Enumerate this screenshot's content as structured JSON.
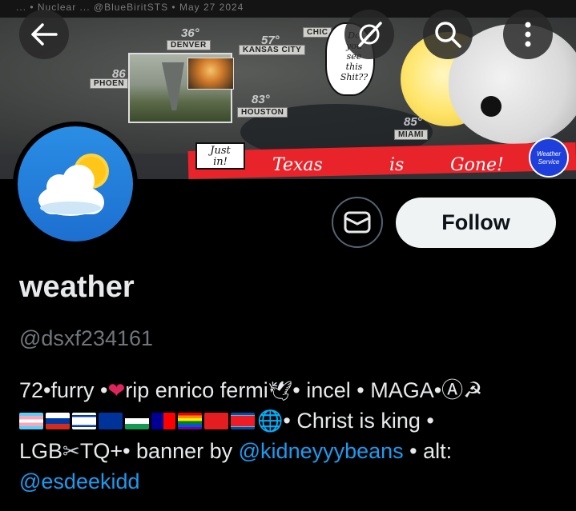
{
  "banner": {
    "top_strip_text": "... • Nuclear ... @BlueBiritSTS • May 27 2024",
    "cities": [
      "DENVER",
      "KANSAS CITY",
      "PHOEN",
      "HOUSTON",
      "MIAMI",
      "CHIC"
    ],
    "temps": [
      "36°",
      "57°",
      "86",
      "83°",
      "85°"
    ],
    "speech_bubble": "Do\nyou\nsee\nthis\nShit??",
    "just_in": "Just\nin!",
    "band_words": [
      "Texas",
      "is",
      "Gone!"
    ],
    "badge_text": "Weather Service"
  },
  "nav": {
    "back_icon": "arrow-left-icon",
    "grok_icon": "slash-circle-icon",
    "search_icon": "search-icon",
    "more_icon": "vertical-dots-icon"
  },
  "profile": {
    "display_name": "weather",
    "handle": "@dsxf234161",
    "message_icon": "envelope-icon",
    "follow_label": "Follow"
  },
  "bio": {
    "line1_a": "72•furry •",
    "line1_b": "rip enrico fermi",
    "line1_c": "• incel • MAGA•Ⓐ☭",
    "line2_a": "• Christ is king •",
    "line3_a": "LGB",
    "line3_b": "TQ+• banner by ",
    "line3_link": "@kidneyyybeans",
    "line3_c": " • alt:",
    "line4_link": "@esdeekidd"
  },
  "colors": {
    "background": "#000000",
    "link": "#1d9bf0",
    "muted": "#71767b",
    "follow_bg": "#eff3f4"
  }
}
